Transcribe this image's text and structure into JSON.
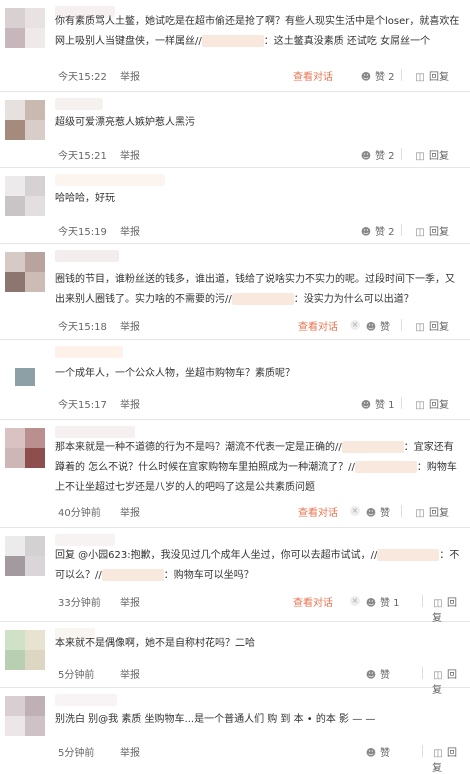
{
  "comments": [
    {
      "text": "你有素质骂人土鳖，她试吃是在超市偷还是抢了啊？有些人现实生活中是个loser，就喜欢在网上吸别人当键盘侠，一样属丝//",
      "text_tail": "：这土鳖真没素质 还试吃 女屌丝一个",
      "time": "今天15:22",
      "report": "举报",
      "view": "查看对话",
      "likes": "赞 2",
      "reply": "回复"
    },
    {
      "text": "超级可爱漂亮惹人嫉妒惹人黑污",
      "time": "今天15:21",
      "report": "举报",
      "likes": "赞 2",
      "reply": "回复"
    },
    {
      "text": "哈哈哈，好玩",
      "time": "今天15:19",
      "report": "举报",
      "likes": "赞 2",
      "reply": "回复"
    },
    {
      "text": "圈钱的节目，谁粉丝送的钱多，谁出道，钱给了说啥实力不实力的呢。过段时间下一季，又出来别人圈钱了。实力啥的不需要的污//",
      "text_tail": "：没实力为什么可以出道？",
      "time": "今天15:18",
      "report": "举报",
      "view": "查看对话",
      "likes": "赞",
      "reply": "回复"
    },
    {
      "text": "一个成年人，一个公众人物，坐超市购物车？素质呢？",
      "time": "今天15:17",
      "report": "举报",
      "likes": "赞 1",
      "reply": "回复"
    },
    {
      "text": "那本来就是一种不道德的行为不是吗？潮流不代表一定是正确的//",
      "text_mid": "：宜家还有蹲着的 怎么不说？什么时候在宜家购物车里拍照成为一种潮流了？//",
      "text_tail": "：购物车上不让坐超过七岁还是八岁的人的吧吗了这是公共素质问题",
      "time": "40分钟前",
      "report": "举报",
      "view": "查看对话",
      "likes": "赞",
      "reply": "回复"
    },
    {
      "text": "回复 @小园623:抱歉，我没见过几个成年人坐过，你可以去超市试试，//",
      "text_mid": "：不可以么？//",
      "text_tail": "：购物车可以坐吗？",
      "time": "33分钟前",
      "report": "举报",
      "view": "查看对话",
      "likes": "赞 1",
      "reply": "回复"
    },
    {
      "text": "本来就不是偶像啊，她不是自称村花吗？二哈",
      "time": "5分钟前",
      "report": "举报",
      "likes": "赞",
      "reply": "回复"
    },
    {
      "text": "别洗白 别@我 素质 坐购物车...是一个普通人们 购 到 本 • 的本 影 — —",
      "time": "5分钟前",
      "report": "举报",
      "likes": "赞",
      "reply": "回复"
    }
  ],
  "icons": {
    "like": "thumbs-up-icon",
    "reply": "reply-icon",
    "delete": "delete-icon"
  },
  "colors": {
    "link": "#eb7350",
    "meta": "#666666",
    "text": "#333333",
    "divider": "#e6e6e6"
  }
}
